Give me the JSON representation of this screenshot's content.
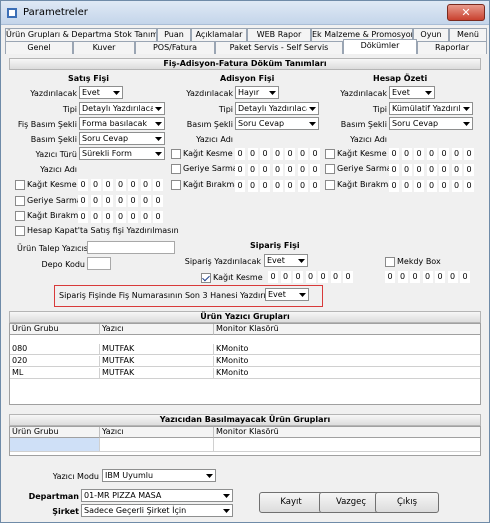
{
  "window": {
    "title": "Parametreler",
    "close": "✕"
  },
  "tabs": {
    "row1": [
      "Ürün Grupları & Departma Stok Tanımları",
      "Puan",
      "Açıklamalar",
      "WEB Rapor",
      "Ek Malzeme & Promosyon",
      "Oyun",
      "Menü"
    ],
    "row2": [
      "Genel",
      "Kuver",
      "POS/Fatura",
      "Paket Servis - Self Servis",
      "Dökümler",
      "Raporlar"
    ]
  },
  "section_title": "Fiş-Adisyon-Fatura Döküm Tanımları",
  "satis": {
    "title": "Satış Fişi",
    "yazdirilacak_lbl": "Yazdırılacak",
    "yazdirilacak": "Evet",
    "tipi_lbl": "Tipi",
    "tipi": "Detaylı Yazdırılacak",
    "basim_lbl": "Fiş Basım Şekli",
    "basim": "Forma basılacak",
    "basim2_lbl": "Basım Şekli",
    "basim2": "Soru Cevap",
    "yazici_turu_lbl": "Yazıcı Türü",
    "yazici_turu": "Sürekli Form",
    "yazici_adi_lbl": "Yazıcı Adı",
    "kagit_kesme": "Kağıt Kesme",
    "geriye_sarma": "Geriye Sarma",
    "kagit_birakma": "Kağıt Bırakma",
    "hesap_kapat": "Hesap Kapat'ta Satış fişi Yazdırılmasın"
  },
  "adisyon": {
    "title": "Adisyon Fişi",
    "yazdirilacak_lbl": "Yazdırılacak",
    "yazdirilacak": "Hayır",
    "tipi_lbl": "Tipi",
    "tipi": "Detaylı Yazdırılacak",
    "basim_lbl": "Basım Şekli",
    "basim": "Soru Cevap",
    "yazici_adi_lbl": "Yazıcı Adı",
    "kagit_kesme": "Kağıt Kesme",
    "geriye_sarma": "Geriye Sarma",
    "kagit_birakma": "Kağıt Bırakma"
  },
  "hesap": {
    "title": "Hesap Özeti",
    "yazdirilacak_lbl": "Yazdırılacak",
    "yazdirilacak": "Evet",
    "tipi_lbl": "Tipi",
    "tipi": "Kümülatif Yazdırılac",
    "basim_lbl": "Basım Şekli",
    "basim": "Soru Cevap",
    "yazici_adi_lbl": "Yazıcı Adı",
    "kagit_kesme": "Kağıt Kesme",
    "geriye_sarma": "Geriye Sarma",
    "kagit_birakma": "Kağıt Bırakma"
  },
  "digit": "0",
  "urun_talep_lbl": "Ürün Talep Yazıcısı",
  "depo_kodu_lbl": "Depo Kodu",
  "siparis": {
    "title": "Sipariş Fişi",
    "yazdirilacak_lbl": "Sipariş Yazdırılacak",
    "yazdirilacak": "Evet",
    "kagit_kesme": "Kağıt Kesme",
    "son3_lbl": "Sipariş Fişinde Fiş Numarasının Son 3 Hanesi Yazdırılacak",
    "son3": "Evet"
  },
  "mekdy_box": "Mekdy Box",
  "urun_yazici": {
    "title": "Ürün Yazıcı Grupları",
    "headers": [
      "Ürün Grubu",
      "Yazıcı",
      "Monitor Klasörü"
    ],
    "rows": [
      [
        "080",
        "MUTFAK",
        "KMonito"
      ],
      [
        "020",
        "MUTFAK",
        "KMonito"
      ],
      [
        "ML",
        "MUTFAK",
        "KMonito"
      ]
    ]
  },
  "basilmayacak": {
    "title": "Yazıcıdan Basılmayacak Ürün Grupları",
    "headers": [
      "Ürün Grubu",
      "Yazıcı",
      "Monitor Klasörü"
    ]
  },
  "yazici_modu_lbl": "Yazıcı Modu",
  "yazici_modu": "IBM Uyumlu",
  "departman_lbl": "Departman",
  "departman": "01-MR PIZZA MASA",
  "sirket_lbl": "Şirket",
  "sirket": "Sadece Geçerli Şirket İçin",
  "buttons": {
    "kayit": "Kayıt",
    "vazgec": "Vazgeç",
    "cikis": "Çıkış"
  },
  "colors": {
    "title_bar": "#c4d5ea",
    "selected_row": "#cfe0f7",
    "highlight_border": "#d83a3a"
  }
}
